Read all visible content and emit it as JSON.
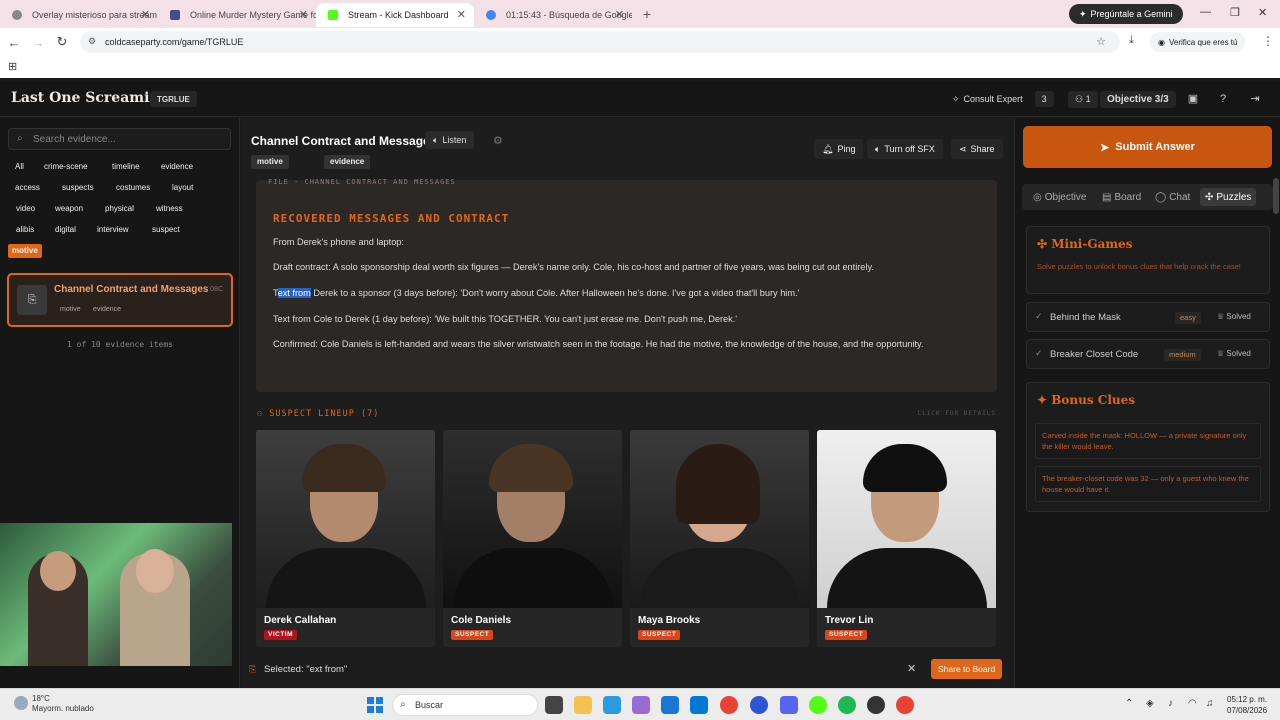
{
  "browser": {
    "tabs": [
      {
        "title": "Overlay misterioso para stream",
        "fav": "#888"
      },
      {
        "title": "Online Murder Mystery Game fo",
        "fav": "#4a4a8a"
      },
      {
        "title": "Stream - Kick Dashboard",
        "fav": "#53fc18"
      },
      {
        "title": "01:15:43 - Búsqueda de Google",
        "fav": "#4285f4"
      }
    ],
    "gemini_label": "Pregúntale a Gemini",
    "url": "coldcaseparty.com/game/TGRLUE",
    "verify_label": "Verifica que eres tú"
  },
  "header": {
    "brand": "Last One Screaming",
    "code": "TGRLUE",
    "consult_label": "Consult Expert",
    "consult_count": "3",
    "players_count": "1",
    "objective_label": "Objective 3/3"
  },
  "sidebar": {
    "search_placeholder": "Search evidence...",
    "tags": [
      "All",
      "crime-scene",
      "timeline",
      "evidence",
      "access",
      "suspects",
      "costumes",
      "layout",
      "video",
      "weapon",
      "physical",
      "witness",
      "alibis",
      "digital",
      "interview",
      "suspect",
      "motive"
    ],
    "active_tag": "motive",
    "card": {
      "title": "Channel Contract and Messages",
      "id": "08C",
      "tags": [
        "motive",
        "evidence"
      ]
    },
    "count_text": "1 of 10 evidence items"
  },
  "main": {
    "title": "Channel Contract and Messages",
    "listen_label": "Listen",
    "tags": [
      "motive",
      "evidence"
    ],
    "ping_label": "Ping",
    "sfx_label": "Turn off SFX",
    "share_label": "Share",
    "doc": {
      "file_label": "FILE - CHANNEL CONTRACT AND MESSAGES",
      "heading": "RECOVERED MESSAGES AND CONTRACT",
      "p1": "From Derek's phone and laptop:",
      "p2": "Draft contract: A solo sponsorship deal worth six figures — Derek's name only. Cole, his co-host and partner of five years, was being cut out entirely.",
      "p3_pre": "T",
      "p3_sel": "ext from",
      "p3_post": " Derek to a sponsor (3 days before): 'Don't worry about Cole. After Halloween he's done. I've got a video that'll bury him.'",
      "p4": "Text from Cole to Derek (1 day before): 'We built this TOGETHER. You can't just erase me. Don't push me, Derek.'",
      "p5": "Confirmed: Cole Daniels is left-handed and wears the silver wristwatch seen in the footage. He had the motive, the knowledge of the house, and the opportunity."
    },
    "lineup_heading": "SUSPECT LINEUP (7)",
    "lineup_hint": "CLICK FOR DETAILS",
    "suspects": [
      {
        "name": "Derek Callahan",
        "badge": "VICTIM"
      },
      {
        "name": "Cole Daniels",
        "badge": "SUSPECT"
      },
      {
        "name": "Maya Brooks",
        "badge": "SUSPECT"
      },
      {
        "name": "Trevor Lin",
        "badge": "SUSPECT"
      }
    ],
    "selection_text": "Selected: \"ext from\"",
    "share_board_label": "Share to Board"
  },
  "right": {
    "submit_label": "Submit Answer",
    "tabs": [
      "Objective",
      "Board",
      "Chat",
      "Puzzles"
    ],
    "minigames_title": "Mini-Games",
    "minigames_desc": "Solve puzzles to unlock bonus clues that help crack the case!",
    "puzzles": [
      {
        "name": "Behind the Mask",
        "difficulty": "easy",
        "status": "Solved"
      },
      {
        "name": "Breaker Closet Code",
        "difficulty": "medium",
        "status": "Solved"
      }
    ],
    "bonus_title": "Bonus Clues",
    "clues": [
      "Carved inside the mask: HOLLOW — a private signature only the killer would leave.",
      "The breaker-closet code was 32 — only a guest who knew the house would have it."
    ]
  },
  "taskbar": {
    "temp": "18°C",
    "weather": "Mayorm. nublado",
    "search_label": "Buscar",
    "time": "05:12 p. m.",
    "date": "07/08/2026"
  }
}
